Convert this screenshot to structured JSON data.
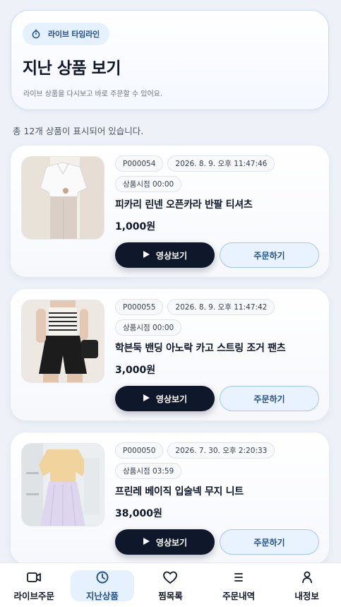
{
  "header": {
    "badge_label": "라이브 타임라인",
    "title": "지난 상품 보기",
    "subtitle": "라이브 상품을 다시보고 바로 주문할 수 있어요."
  },
  "summary": "총 12개 상품이 표시되어 있습니다.",
  "products": [
    {
      "code": "P000054",
      "datetime": "2026. 8. 9. 오후 11:47:46",
      "time_label": "상품시점 00:00",
      "name": "피카리 린넨 오픈카라 반팔 티셔츠",
      "price": "1,000원",
      "video_label": "영상보기",
      "order_label": "주문하기"
    },
    {
      "code": "P000055",
      "datetime": "2026. 8. 9. 오후 11:47:42",
      "time_label": "상품시점 00:00",
      "name": "학븐둑 밴딩 아노락 카고 스트링 조거 팬츠",
      "price": "3,000원",
      "video_label": "영상보기",
      "order_label": "주문하기"
    },
    {
      "code": "P000050",
      "datetime": "2026. 7. 30. 오후 2:20:33",
      "time_label": "상품시점 03:59",
      "name": "프린레 베이직 입술넥 무지 니트",
      "price": "38,000원",
      "video_label": "영상보기",
      "order_label": "주문하기"
    }
  ],
  "nav": [
    {
      "label": "라이브주문",
      "icon": "video-camera-icon",
      "active": false
    },
    {
      "label": "지난상품",
      "icon": "clock-icon",
      "active": true
    },
    {
      "label": "찜목록",
      "icon": "heart-icon",
      "active": false
    },
    {
      "label": "주문내역",
      "icon": "list-icon",
      "active": false
    },
    {
      "label": "내정보",
      "icon": "user-icon",
      "active": false
    }
  ],
  "colors": {
    "accent": "#1f4f8f",
    "dark_button": "#0f172a",
    "light_button": "#e9f3ff",
    "background": "#eef2f8"
  }
}
